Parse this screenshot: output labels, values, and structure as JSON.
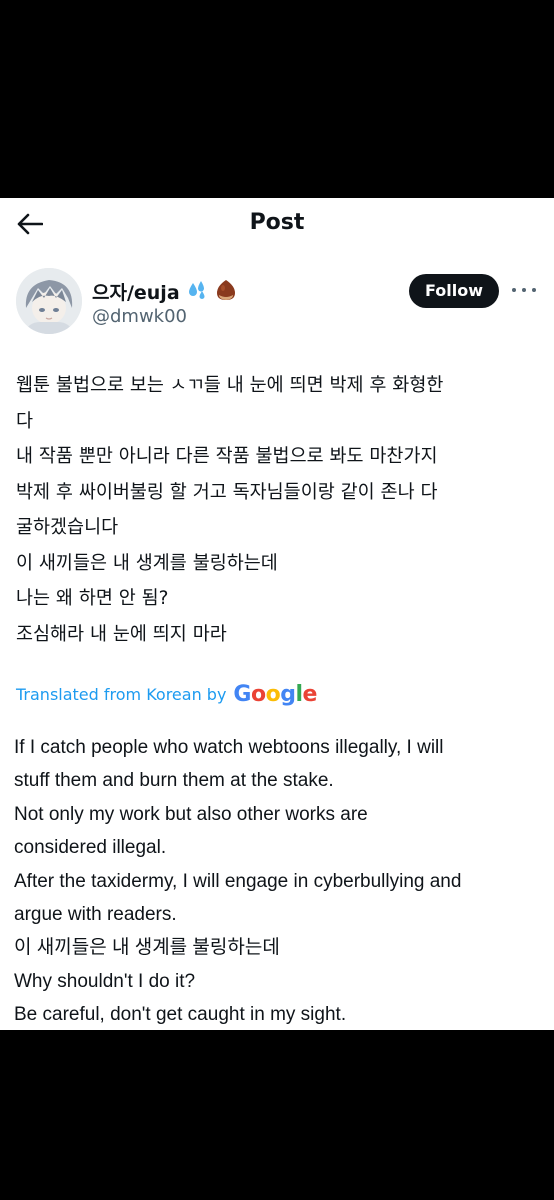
{
  "header": {
    "title": "Post",
    "back_icon": "back-arrow-icon"
  },
  "author": {
    "display_name": "으자/euja",
    "emojis": [
      "sweat-droplets-emoji",
      "chestnut-emoji"
    ],
    "handle": "@dmwk00",
    "follow_label": "Follow",
    "more_icon": "more-dots-icon"
  },
  "post": {
    "original_lines": [
      "웹툰 불법으로 보는 ㅅㄲ들 내 눈에 띄면 박제 후 화형한",
      "다",
      "내 작품 뿐만 아니라 다른 작품 불법으로 봐도 마찬가지",
      "박제 후 싸이버불링 할 거고 독자님들이랑 같이 존나 다",
      "굴하겠습니다",
      "이 새끼들은 내 생계를 불링하는데",
      "나는 왜 하면 안 됨?",
      "조심해라 내 눈에 띄지 마라"
    ],
    "translated_label": "Translated from Korean by",
    "translator_brand": "Google",
    "google_colors": [
      "#4285F4",
      "#EA4335",
      "#FBBC05",
      "#4285F4",
      "#34A853",
      "#EA4335"
    ],
    "translated_lines": [
      "If I catch people who watch webtoons illegally, I will",
      "stuff them and burn them at the stake.",
      "Not only my work but also other works are",
      "considered illegal.",
      "After the taxidermy, I will engage in cyberbullying and",
      "argue with readers.",
      "이 새끼들은 내 생계를 불링하는데",
      "Why shouldn't I do it?",
      "Be careful, don't get caught in my sight."
    ]
  },
  "colors": {
    "text": "#0f1419",
    "secondary": "#536471",
    "link": "#1d9bf0",
    "button": "#0f1419"
  }
}
